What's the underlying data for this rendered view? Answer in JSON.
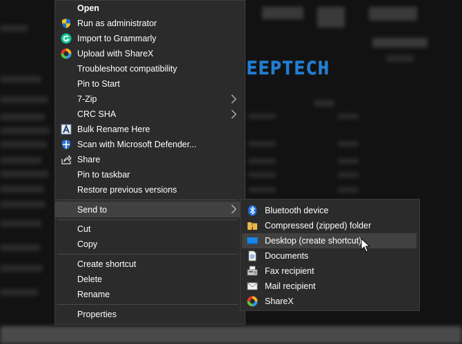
{
  "watermark": "DEEPTECH",
  "context_menu": {
    "items": [
      {
        "label": "Open",
        "icon": "none"
      },
      {
        "label": "Run as administrator",
        "icon": "uac-shield-icon"
      },
      {
        "label": "Import to Grammarly",
        "icon": "grammarly-icon"
      },
      {
        "label": "Upload with ShareX",
        "icon": "sharex-icon"
      },
      {
        "label": "Troubleshoot compatibility",
        "icon": "none"
      },
      {
        "label": "Pin to Start",
        "icon": "none"
      },
      {
        "label": "7-Zip",
        "icon": "none"
      },
      {
        "label": "CRC SHA",
        "icon": "none"
      },
      {
        "label": "Bulk Rename Here",
        "icon": "bulk-rename-icon"
      },
      {
        "label": "Scan with Microsoft Defender...",
        "icon": "defender-icon"
      },
      {
        "label": "Share",
        "icon": "share-icon"
      },
      {
        "label": "Pin to taskbar",
        "icon": "none"
      },
      {
        "label": "Restore previous versions",
        "icon": "none"
      },
      {
        "label": "Send to",
        "icon": "none"
      },
      {
        "label": "Cut",
        "icon": "none"
      },
      {
        "label": "Copy",
        "icon": "none"
      },
      {
        "label": "Create shortcut",
        "icon": "none"
      },
      {
        "label": "Delete",
        "icon": "none"
      },
      {
        "label": "Rename",
        "icon": "none"
      },
      {
        "label": "Properties",
        "icon": "none"
      }
    ]
  },
  "send_to_menu": {
    "items": [
      {
        "label": "Bluetooth device",
        "icon": "bluetooth-icon"
      },
      {
        "label": "Compressed (zipped) folder",
        "icon": "zip-folder-icon"
      },
      {
        "label": "Desktop (create shortcut)",
        "icon": "desktop-icon"
      },
      {
        "label": "Documents",
        "icon": "documents-icon"
      },
      {
        "label": "Fax recipient",
        "icon": "fax-icon"
      },
      {
        "label": "Mail recipient",
        "icon": "mail-icon"
      },
      {
        "label": "ShareX",
        "icon": "sharex-icon"
      }
    ]
  },
  "colors": {
    "menu_bg": "#2b2b2b",
    "highlight": "#414141",
    "watermark": "#1f7fd6",
    "shield_blue": "#1e6fd9",
    "shield_yellow": "#f0c419",
    "grammarly_green": "#15c39a"
  }
}
